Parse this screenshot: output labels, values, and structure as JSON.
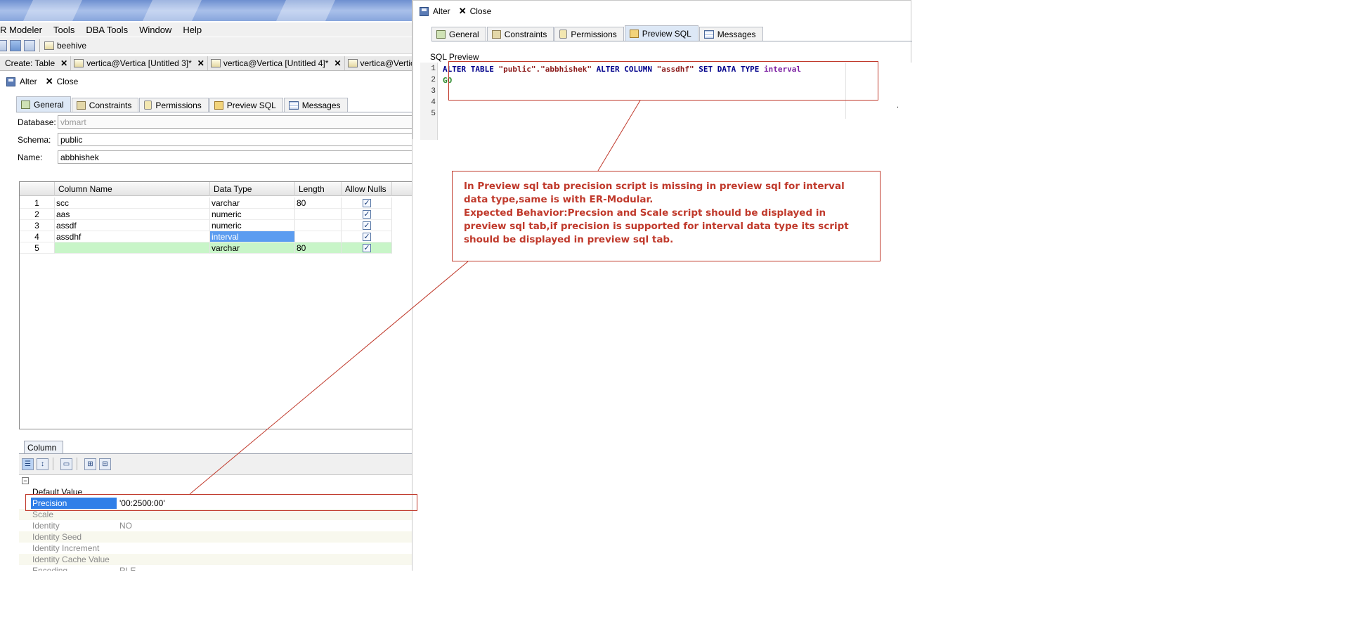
{
  "left_window": {
    "menu": [
      "R Modeler",
      "Tools",
      "DBA Tools",
      "Window",
      "Help"
    ],
    "toolbar_label": "beehive",
    "doc_tabs": [
      {
        "label": "Create: Table",
        "close": "✕"
      },
      {
        "label": "vertica@Vertica [Untitled 3]*",
        "close": "✕"
      },
      {
        "label": "vertica@Vertica [Untitled 4]*",
        "close": "✕"
      },
      {
        "label": "vertica@Vertica",
        "close": ""
      }
    ],
    "alter_label": "Alter",
    "close_label": "Close",
    "sub_tabs": [
      "General",
      "Constraints",
      "Permissions",
      "Preview SQL",
      "Messages"
    ],
    "form": {
      "database_label": "Database:",
      "database_value": "vbmart",
      "schema_label": "Schema:",
      "schema_value": "public",
      "name_label": "Name:",
      "name_value": "abbhishek"
    },
    "grid": {
      "headers": [
        "Column Name",
        "Data Type",
        "Length",
        "Allow Nulls"
      ],
      "rows": [
        {
          "num": "1",
          "name": "scc",
          "type": "varchar",
          "length": "80",
          "nulls": "✓"
        },
        {
          "num": "2",
          "name": "aas",
          "type": "numeric",
          "length": "",
          "nulls": "✓"
        },
        {
          "num": "3",
          "name": "assdf",
          "type": "numeric",
          "length": "",
          "nulls": "✓"
        },
        {
          "num": "4",
          "name": "assdhf",
          "type": "interval",
          "length": "",
          "nulls": "✓"
        },
        {
          "num": "5",
          "name": "",
          "type": "varchar",
          "length": "80",
          "nulls": "✓"
        }
      ]
    },
    "column_panel": {
      "tab_label": "Column",
      "properties": [
        {
          "key": "Default Value",
          "value": ""
        },
        {
          "key": "Precision",
          "value": "'00:2500:00'"
        },
        {
          "key": "Scale",
          "value": ""
        },
        {
          "key": "Identity",
          "value": "NO"
        },
        {
          "key": "Identity Seed",
          "value": ""
        },
        {
          "key": "Identity Increment",
          "value": ""
        },
        {
          "key": "Identity Cache Value",
          "value": ""
        },
        {
          "key": "Encoding",
          "value": "RLE"
        }
      ]
    }
  },
  "right_window": {
    "alter_label": "Alter",
    "close_label": "Close",
    "sub_tabs": [
      "General",
      "Constraints",
      "Permissions",
      "Preview SQL",
      "Messages"
    ],
    "sql_preview_label": "SQL Preview",
    "line_numbers": [
      "1",
      "2",
      "3",
      "4",
      "5"
    ],
    "sql": {
      "alter_kw": "ALTER TABLE",
      "table_name": "\"public\".\"abbhishek\"",
      "alter_col_kw": "ALTER COLUMN",
      "column_name": "\"assdhf\"",
      "set_kw": "SET DATA TYPE",
      "type": "interval",
      "go": "GO"
    }
  },
  "annotation": {
    "line1": "In Preview sql tab precision script is missing in preview sql for interval data type,same is with ER-Modular.",
    "line2": "Expected Behavior:Precsion and Scale script should be displayed in preview sql tab,if precision is supported for interval data type its script should be displayed in preview sql tab.",
    "color": "#c0392b"
  }
}
